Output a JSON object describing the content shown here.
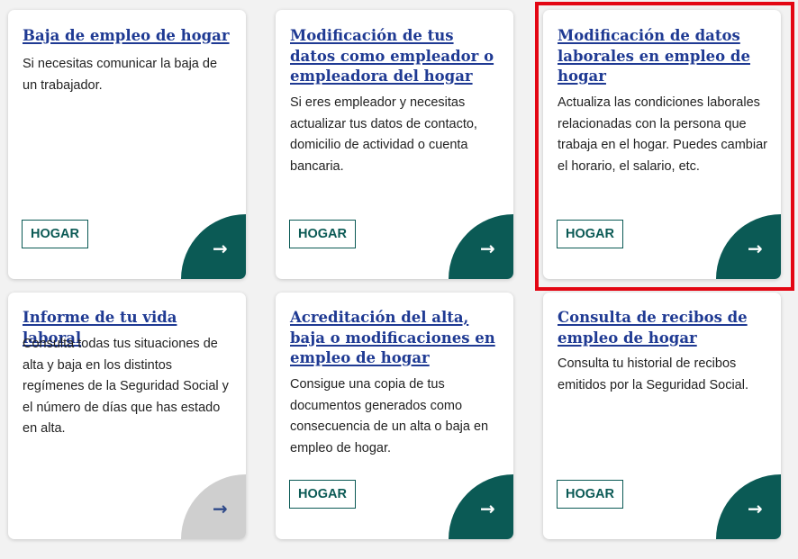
{
  "cards": [
    {
      "title": "Baja de empleo de hogar",
      "description": "Si necesitas comunicar la baja de un trabajador.",
      "tag": "HOGAR",
      "arrow": "→",
      "arrow_state": "active"
    },
    {
      "title": "Modificación de tus datos como empleador o empleadora del hogar",
      "description": "Si eres empleador y necesitas actualizar tus datos de contacto, domicilio de actividad o cuenta bancaria.",
      "tag": "HOGAR",
      "arrow": "→",
      "arrow_state": "active"
    },
    {
      "title": "Modificación de datos laborales en empleo de hogar",
      "description": "Actualiza las condiciones laborales relacionadas con la persona que trabaja en el hogar. Puedes cambiar el horario, el salario, etc.",
      "tag": "HOGAR",
      "arrow": "→",
      "arrow_state": "active",
      "highlighted": true
    },
    {
      "title": "Informe de tu vida laboral",
      "description": "Consulta todas tus situaciones de alta y baja en los distintos regímenes de la Seguridad Social y el número de días que has estado en alta.",
      "arrow": "→",
      "arrow_state": "disabled"
    },
    {
      "title": "Acreditación del alta, baja o modificaciones en empleo de hogar",
      "description": "Consigue una copia de tus documentos generados como consecuencia de un alta o baja en empleo de hogar.",
      "tag": "HOGAR",
      "arrow": "→",
      "arrow_state": "active"
    },
    {
      "title": "Consulta de recibos de empleo de hogar",
      "description": "Consulta tu historial de recibos emitidos por la Seguridad Social.",
      "tag": "HOGAR",
      "arrow": "→",
      "arrow_state": "active"
    }
  ],
  "colors": {
    "title_link": "#1f3a93",
    "accent_teal": "#0b5a55",
    "highlight_border": "#e30613",
    "disabled_arrow_bg": "#cfcfcf"
  }
}
